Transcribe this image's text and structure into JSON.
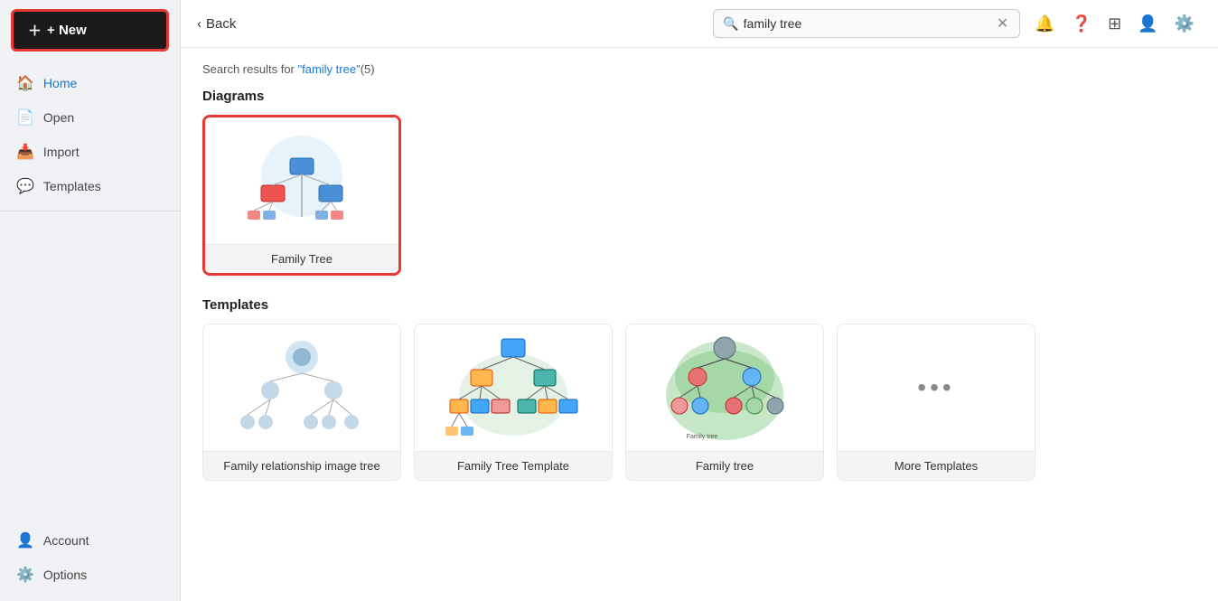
{
  "sidebar": {
    "new_button_label": "+ New",
    "nav_items": [
      {
        "id": "home",
        "label": "Home",
        "icon": "🏠",
        "active": true
      },
      {
        "id": "open",
        "label": "Open",
        "icon": "📄",
        "active": false
      },
      {
        "id": "import",
        "label": "Import",
        "icon": "📥",
        "active": false
      },
      {
        "id": "templates",
        "label": "Templates",
        "icon": "💬",
        "active": false
      }
    ],
    "bottom_items": [
      {
        "id": "account",
        "label": "Account",
        "icon": "👤"
      },
      {
        "id": "options",
        "label": "Options",
        "icon": "⚙️"
      }
    ]
  },
  "topbar": {
    "back_label": "Back",
    "search_value": "family tree",
    "search_placeholder": "Search templates..."
  },
  "content": {
    "results_prefix": "Search results for ",
    "results_query": "\"family tree\"",
    "results_count": "(5)",
    "diagrams_section_title": "Diagrams",
    "templates_section_title": "Templates",
    "diagram_cards": [
      {
        "id": "family-tree-diagram",
        "label": "Family Tree",
        "selected": true
      }
    ],
    "template_cards": [
      {
        "id": "family-rel-image",
        "label": "Family relationship image tree"
      },
      {
        "id": "family-tree-template",
        "label": "Family Tree Template"
      },
      {
        "id": "family-tree",
        "label": "Family tree"
      },
      {
        "id": "more-templates",
        "label": "More Templates",
        "more": true
      }
    ]
  }
}
